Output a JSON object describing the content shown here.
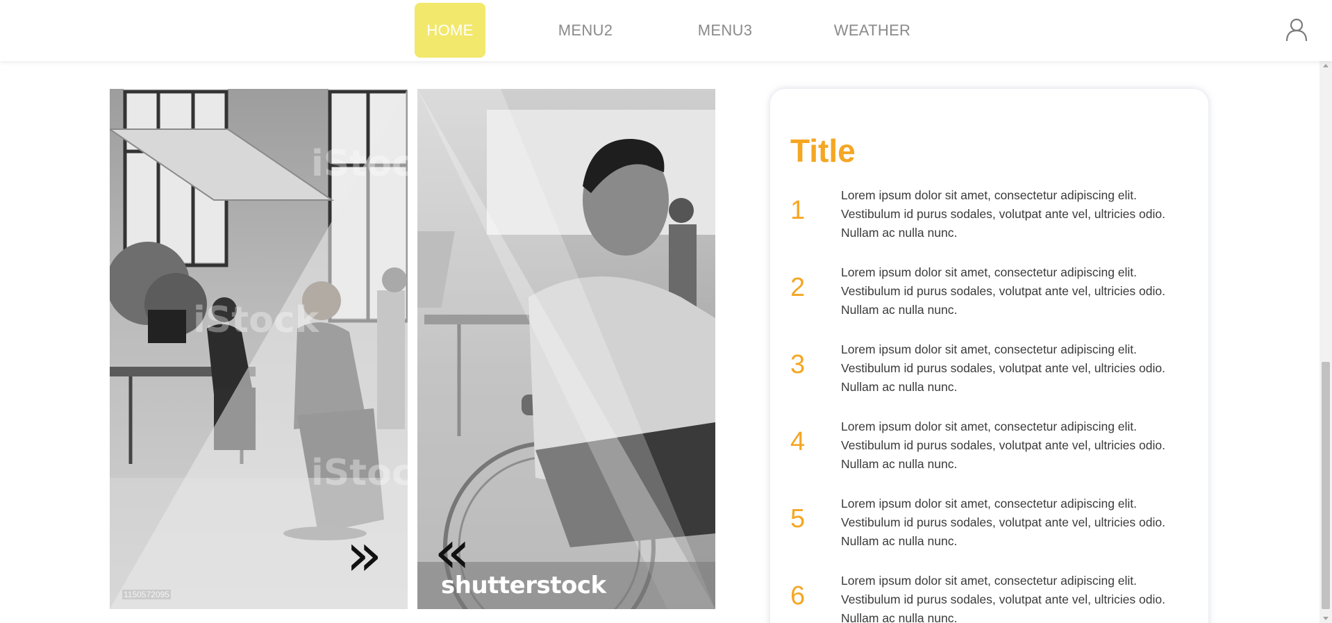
{
  "nav": {
    "items": [
      {
        "label": "HOME",
        "active": true
      },
      {
        "label": "MENU2",
        "active": false
      },
      {
        "label": "MENU3",
        "active": false
      },
      {
        "label": "WEATHER",
        "active": false
      }
    ],
    "user_icon": "user-icon"
  },
  "colors": {
    "nav_active_bg": "#f2e86c",
    "accent_orange": "#f5a623",
    "nav_text": "#8a8a8a"
  },
  "slider": {
    "next_icon": "chevron-double-right-icon",
    "next_glyph": "»",
    "prev_icon": "chevron-double-left-icon",
    "prev_glyph": "«",
    "left_image_id": "1150572095",
    "watermark": "shutterstock"
  },
  "card": {
    "title": "Title",
    "items": [
      {
        "number": "1",
        "text": "Lorem ipsum dolor sit amet, consectetur adipiscing elit. Vestibulum id purus sodales, volutpat ante vel, ultricies odio. Nullam ac nulla nunc."
      },
      {
        "number": "2",
        "text": "Lorem ipsum dolor sit amet, consectetur adipiscing elit. Vestibulum id purus sodales, volutpat ante vel, ultricies odio. Nullam ac nulla nunc."
      },
      {
        "number": "3",
        "text": "Lorem ipsum dolor sit amet, consectetur adipiscing elit. Vestibulum id purus sodales, volutpat ante vel, ultricies odio. Nullam ac nulla nunc."
      },
      {
        "number": "4",
        "text": "Lorem ipsum dolor sit amet, consectetur adipiscing elit. Vestibulum id purus sodales, volutpat ante vel, ultricies odio. Nullam ac nulla nunc."
      },
      {
        "number": "5",
        "text": "Lorem ipsum dolor sit amet, consectetur adipiscing elit. Vestibulum id purus sodales, volutpat ante vel, ultricies odio. Nullam ac nulla nunc."
      },
      {
        "number": "6",
        "text": "Lorem ipsum dolor sit amet, consectetur adipiscing elit. Vestibulum id purus sodales, volutpat ante vel, ultricies odio. Nullam ac nulla nunc."
      }
    ]
  }
}
